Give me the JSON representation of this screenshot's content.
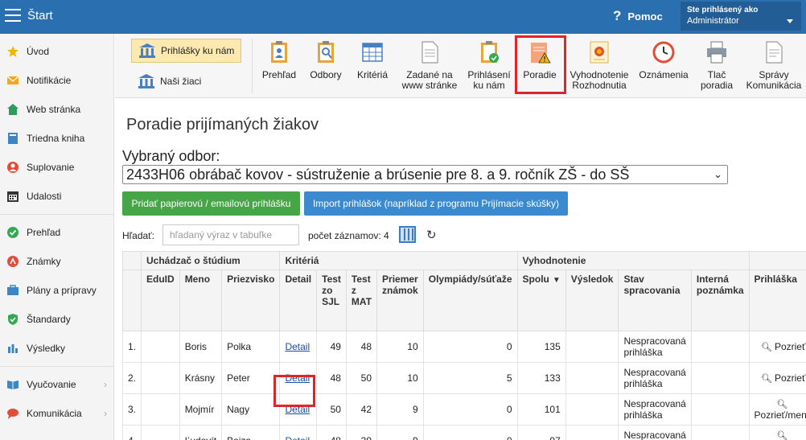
{
  "topbar": {
    "title": "Štart",
    "help_label": "Pomoc",
    "user_line1": "Ste prihlásený ako",
    "user_line2": "Administrátor"
  },
  "sidebar": {
    "items": [
      {
        "label": "Úvod",
        "icon": "star-icon"
      },
      {
        "label": "Notifikácie",
        "icon": "envelope-icon"
      },
      {
        "label": "Web stránka",
        "icon": "home-icon"
      },
      {
        "label": "Triedna kniha",
        "icon": "book-icon"
      },
      {
        "label": "Suplovanie",
        "icon": "person-icon"
      },
      {
        "label": "Udalosti",
        "icon": "calendar-icon"
      },
      {
        "label": "Prehľad",
        "icon": "check-circle-icon"
      },
      {
        "label": "Známky",
        "icon": "grade-icon"
      },
      {
        "label": "Plány a prípravy",
        "icon": "briefcase-icon"
      },
      {
        "label": "Štandardy",
        "icon": "shield-icon"
      },
      {
        "label": "Výsledky",
        "icon": "bar-chart-icon"
      },
      {
        "label": "Vyučovanie",
        "icon": "book-open-icon"
      },
      {
        "label": "Komunikácia",
        "icon": "chat-icon"
      }
    ]
  },
  "ribbon": {
    "tab_active": "Prihlášky ku nám",
    "tab_other": "Naši žiaci",
    "buttons": [
      {
        "label": "Prehľad"
      },
      {
        "label": "Odbory"
      },
      {
        "label": "Kritériá"
      },
      {
        "label": "Zadané na www stránke"
      },
      {
        "label": "Prihlásení ku nám"
      },
      {
        "label": "Poradie"
      },
      {
        "label": "Vyhodnotenie Rozhodnutia"
      },
      {
        "label": "Oznámenia"
      },
      {
        "label": "Tlač poradia"
      },
      {
        "label": "Správy Komunikácia"
      }
    ]
  },
  "main": {
    "title": "Poradie prijímaných žiakov",
    "field_label": "Vybraný odbor:",
    "selected_field": "2433H06 obrábač kovov - sústruženie a brúsenie pre 8. a 9. ročník ZŠ - do SŠ",
    "btn_add": "Pridať papierovú / emailovú prihlášku",
    "btn_import": "Import prihlášok (napríklad z programu Prijímacie skúšky)",
    "search_label": "Hľadať:",
    "search_placeholder": "hľadaný výraz v tabuľke",
    "count_label": "počet záznamov: 4"
  },
  "table": {
    "group_headers": [
      "Uchádzač o štúdium",
      "Kritériá",
      "Vyhodnotenie",
      "Prihláška"
    ],
    "col_headers": [
      "EduID",
      "Meno",
      "Priezvisko",
      "Detail",
      "Test zo SJL",
      "Test z MAT",
      "Priemer známok",
      "Olympiády/súťaže",
      "Spolu",
      "Výsledok",
      "Stav spracovania",
      "Interná poznámka",
      "Prihláška"
    ],
    "rows": [
      {
        "n": "1.",
        "eduid": "",
        "meno": "Boris",
        "priezvisko": "Polka",
        "detail": "Detail",
        "sjl": "49",
        "mat": "48",
        "priemer": "10",
        "olymp": "0",
        "spolu": "135",
        "vysledok": "",
        "stav": "Nespracovaná prihláška",
        "poznamka": "",
        "action": "Pozrieť"
      },
      {
        "n": "2.",
        "eduid": "",
        "meno": "Krásny",
        "priezvisko": "Peter",
        "detail": "Detail",
        "sjl": "48",
        "mat": "50",
        "priemer": "10",
        "olymp": "5",
        "spolu": "133",
        "vysledok": "",
        "stav": "Nespracovaná prihláška",
        "poznamka": "",
        "action": "Pozrieť"
      },
      {
        "n": "3.",
        "eduid": "",
        "meno": "Mojmír",
        "priezvisko": "Nagy",
        "detail": "Detail",
        "sjl": "50",
        "mat": "42",
        "priemer": "9",
        "olymp": "0",
        "spolu": "101",
        "vysledok": "",
        "stav": "Nespracovaná prihláška",
        "poznamka": "",
        "action": "Pozrieť/meniť"
      },
      {
        "n": "4.",
        "eduid": "",
        "meno": "Ľudovít",
        "priezvisko": "Bajza",
        "detail": "Detail",
        "sjl": "48",
        "mat": "39",
        "priemer": "9",
        "olymp": "0",
        "spolu": "97",
        "vysledok": "",
        "stav": "Nespracovaná prihláška",
        "poznamka": "",
        "action": "Pozrieť/meniť"
      }
    ]
  },
  "colors": {
    "topbar": "#2a6fb0",
    "highlight": "#e0242a",
    "green_button": "#46a546",
    "blue_button": "#3b8ad0"
  }
}
